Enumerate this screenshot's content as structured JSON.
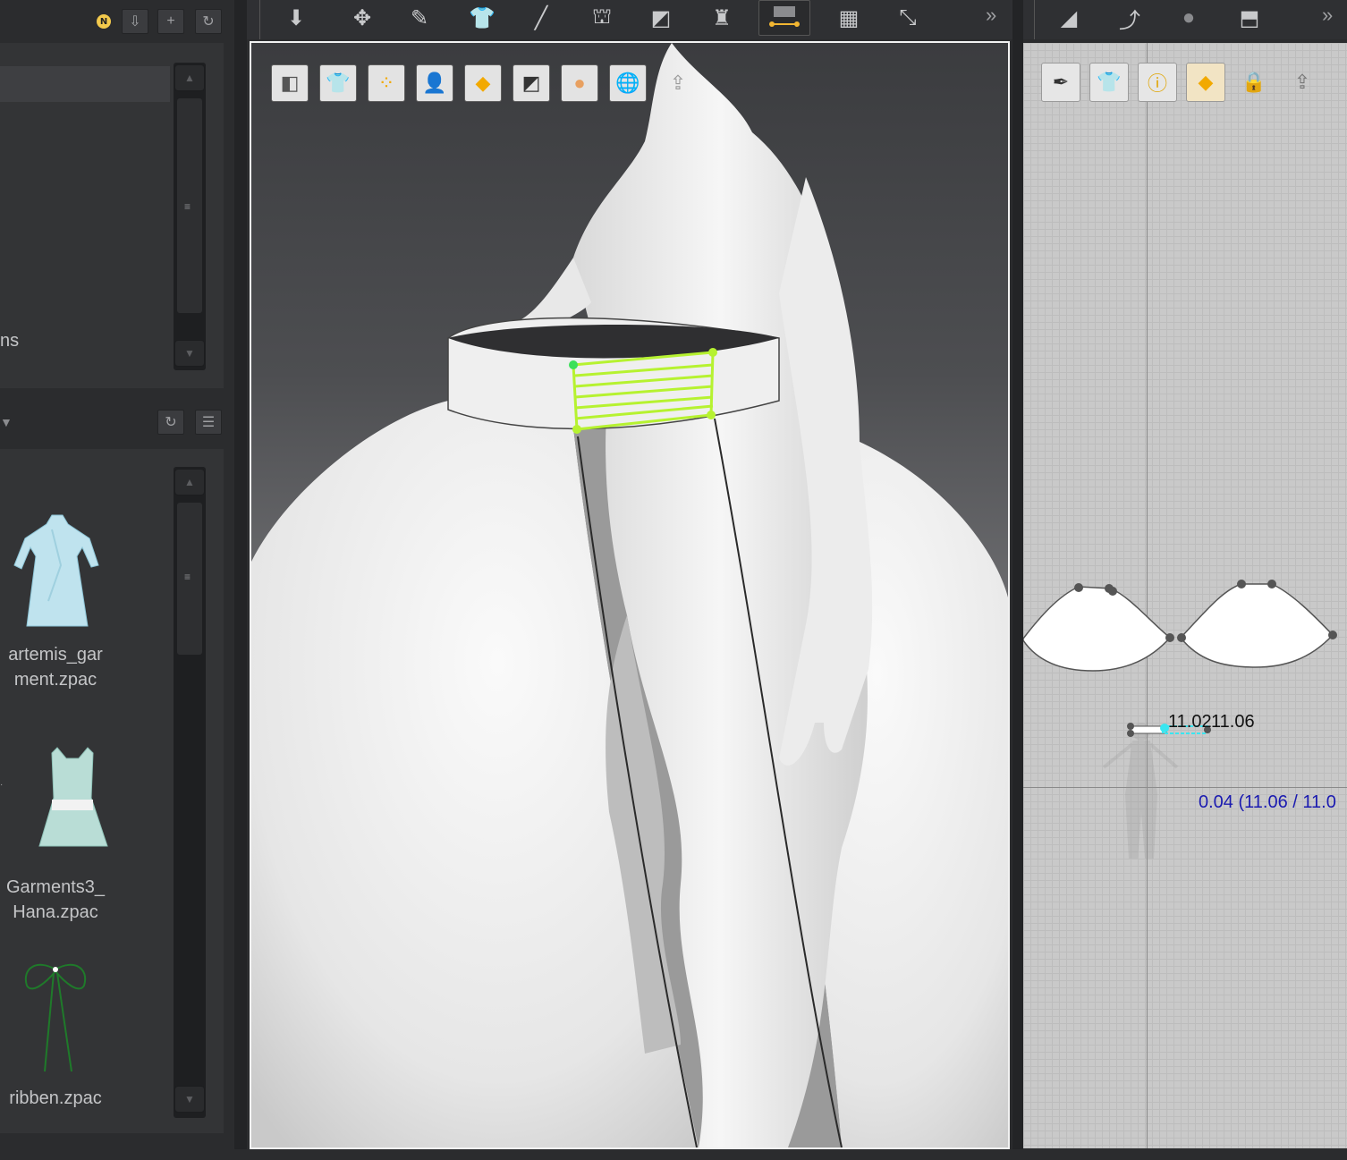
{
  "library": {
    "header_badge": "N",
    "tree_partial_label": "ns",
    "files": [
      {
        "label": "artemis_gar\nment.zpac"
      },
      {
        "label": "Garments3_\nHana.zpac"
      },
      {
        "label": "ribben.zpac"
      }
    ]
  },
  "toolbar_3d": {
    "tools": [
      "select-mesh-icon",
      "transform-icon",
      "brush-icon",
      "avatar-garment-icon",
      "needle-icon",
      "arrangement-icon",
      "fold-icon",
      "mannequin-icon",
      "tack-icon",
      "grid-icon",
      "pin-icon"
    ]
  },
  "view_3d": {
    "quick_buttons": [
      "cube-icon",
      "garment-eye-icon",
      "particles-icon",
      "avatar-eye-icon",
      "texture-icon",
      "shading-icon",
      "avatar-icon",
      "globe-icon",
      "measure-icon"
    ]
  },
  "toolbar_2d": {
    "tools": [
      "segment-icon",
      "curve-point-icon",
      "circle-icon",
      "pattern-icon"
    ]
  },
  "view_2d": {
    "quick_buttons": [
      "pen-eye-icon",
      "shirt-eye-icon",
      "info-icon",
      "texture-icon",
      "lock-shirt-icon",
      "measure-icon"
    ],
    "seam_label_a": "11.02",
    "seam_label_b": "11.06",
    "seam_readout": "0.04 (11.06 / 11.0"
  },
  "colors": {
    "seam_green": "#b6f230",
    "seam_blue": "#1a1ab0",
    "cyan": "#39e6f0"
  }
}
